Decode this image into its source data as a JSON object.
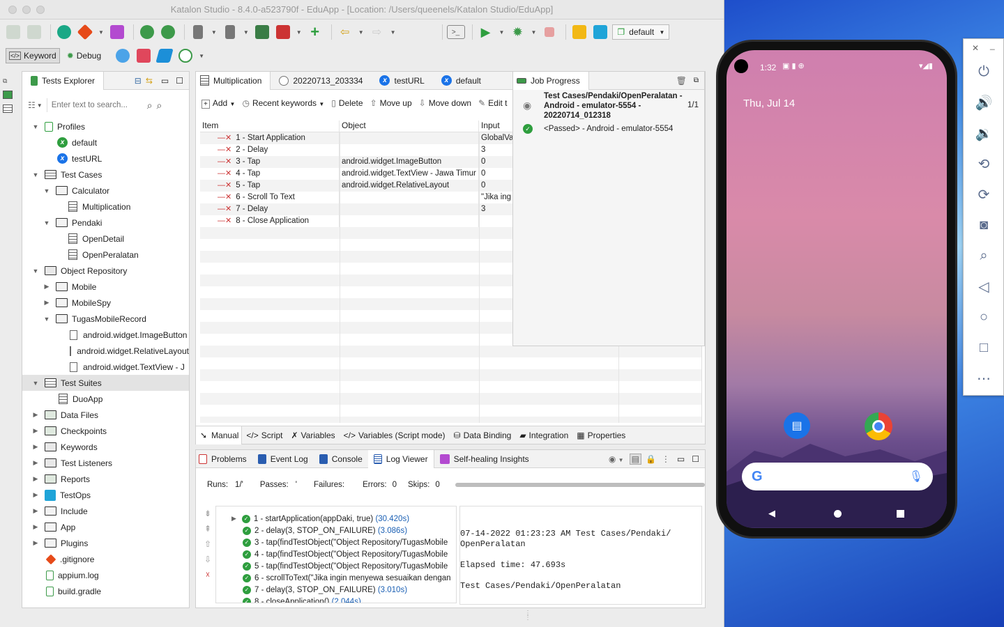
{
  "window": {
    "title": "Katalon Studio - 8.4.0-a523790f - EduApp - [Location: /Users/queenels/Katalon Studio/EduApp]"
  },
  "toolbar": {
    "keyword": "Keyword",
    "debug": "Debug",
    "profile": "default"
  },
  "explorer": {
    "title": "Tests Explorer",
    "search_placeholder": "Enter text to search...",
    "items": [
      "Profiles",
      "default",
      "testURL",
      "Test Cases",
      "Calculator",
      "Multiplication",
      "Pendaki",
      "OpenDetail",
      "OpenPeralatan",
      "Object Repository",
      "Mobile",
      "MobileSpy",
      "TugasMobileRecord",
      "android.widget.ImageButton",
      "android.widget.RelativeLayout",
      "android.widget.TextView - J",
      "Test Suites",
      "DuoApp",
      "Data Files",
      "Checkpoints",
      "Keywords",
      "Test Listeners",
      "Reports",
      "TestOps",
      "Include",
      "App",
      "Plugins",
      ".gitignore",
      "appium.log",
      "build.gradle"
    ]
  },
  "editor": {
    "tabs": [
      "Multiplication",
      "20220713_203334",
      "testURL",
      "default"
    ],
    "toolbar": [
      "Add",
      "Recent keywords",
      "Delete",
      "Move up",
      "Move down",
      "Edit t"
    ],
    "columns": [
      "Item",
      "Object",
      "Input"
    ],
    "rows": [
      {
        "item": "1 - Start Application",
        "object": "",
        "input": "GlobalVa"
      },
      {
        "item": "2 - Delay",
        "object": "",
        "input": "3"
      },
      {
        "item": "3 - Tap",
        "object": "android.widget.ImageButton",
        "input": "0"
      },
      {
        "item": "4 - Tap",
        "object": "android.widget.TextView - Jawa Timur",
        "input": "0"
      },
      {
        "item": "5 - Tap",
        "object": "android.widget.RelativeLayout",
        "input": "0"
      },
      {
        "item": "6 - Scroll To Text",
        "object": "",
        "input": "\"Jika ing"
      },
      {
        "item": "7 - Delay",
        "object": "",
        "input": "3"
      },
      {
        "item": "8 - Close Application",
        "object": "",
        "input": ""
      }
    ],
    "bottom_tabs": [
      "Manual",
      "Script",
      "Variables",
      "Variables (Script mode)",
      "Data Binding",
      "Integration",
      "Properties"
    ]
  },
  "job": {
    "title": "Job Progress",
    "name": "Test Cases/Pendaki/OpenPeralatan - Android - emulator-5554 - 20220714_012318",
    "count": "1/1",
    "status": "<Passed> - Android - emulator-5554"
  },
  "console": {
    "tabs": [
      "Problems",
      "Event Log",
      "Console",
      "Log Viewer",
      "Self-healing Insights"
    ],
    "runs_label": "Runs:",
    "runs": "1/'",
    "passes_label": "Passes:",
    "passes": "'",
    "failures_label": "Failures:",
    "errors_label": "Errors:",
    "errors": "0",
    "skips_label": "Skips:",
    "skips": "0",
    "steps": [
      {
        "text": "1 - startApplication(appDaki, true)",
        "time": "(30.420s)"
      },
      {
        "text": "2 - delay(3, STOP_ON_FAILURE)",
        "time": "(3.086s)"
      },
      {
        "text": "3 - tap(findTestObject(\"Object Repository/TugasMobile",
        "time": ""
      },
      {
        "text": "4 - tap(findTestObject(\"Object Repository/TugasMobile",
        "time": ""
      },
      {
        "text": "5 - tap(findTestObject(\"Object Repository/TugasMobile",
        "time": ""
      },
      {
        "text": "6 - scrollToText(\"Jika ingin menyewa sesuaikan dengan",
        "time": ""
      },
      {
        "text": "7 - delay(3, STOP_ON_FAILURE)",
        "time": "(3.010s)"
      },
      {
        "text": "8 - closeApplication()",
        "time": "(2.044s)"
      }
    ],
    "detail": [
      "07-14-2022 01:23:23 AM Test Cases/Pendaki/",
      "OpenPeralatan",
      "",
      "Elapsed time: 47.693s",
      "",
      "Test Cases/Pendaki/OpenPeralatan"
    ]
  },
  "phone": {
    "time": "1:32",
    "date": "Thu, Jul 14"
  }
}
